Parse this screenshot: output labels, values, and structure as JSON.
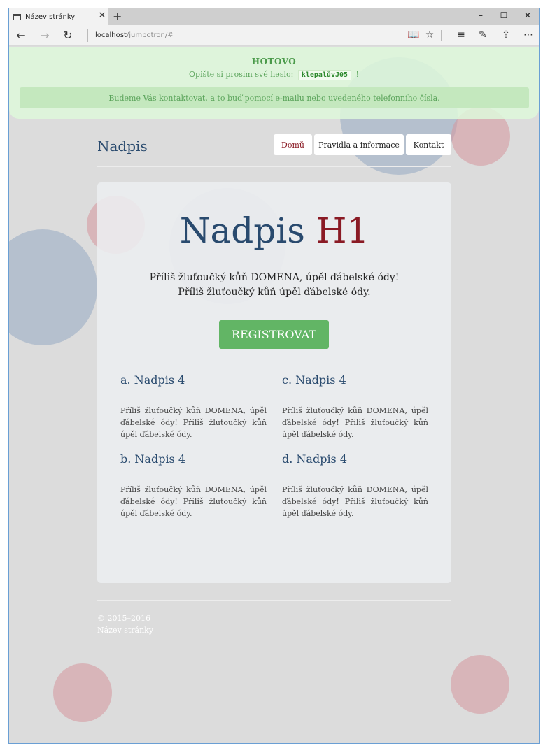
{
  "browser": {
    "tab_title": "Název stránky",
    "tab_close": "✕",
    "new_tab": "+",
    "url_host": "localhost",
    "url_path": "/jumbotron/#",
    "minimize": "–",
    "maximize": "☐",
    "close": "✕"
  },
  "alert": {
    "title": "HOTOVO",
    "prompt": "Opište si prosím své heslo:",
    "password": "klepalůvJ05",
    "suffix": "!",
    "info": "Budeme Vás kontaktovat, a to buď pomocí e-mailu nebo uvedeného telefonního čísla."
  },
  "nav": {
    "brand": "Nadpis",
    "items": [
      {
        "label": "Domů",
        "active": true
      },
      {
        "label": "Pravidla a informace",
        "active": false
      },
      {
        "label": "Kontakt",
        "active": false
      }
    ]
  },
  "jumbotron": {
    "title": "Nadpis",
    "title_accent": "H1",
    "lead_1": "Příliš žluťoučký kůň DOMENA, úpěl ďábelské ódy!",
    "lead_2": "Příliš žluťoučký kůň úpěl ďábelské ódy.",
    "button": "REGISTROVAT",
    "columns": [
      {
        "heading": "a. Nadpis 4",
        "text": "Příliš žluťoučký kůň DOMENA, úpěl ďábelské ódy! Příliš žluťoučký kůň úpěl ďábelské ódy."
      },
      {
        "heading": "c. Nadpis 4",
        "text": "Příliš žluťoučký kůň DOMENA, úpěl ďábelské ódy! Příliš žluťoučký kůň úpěl ďábelské ódy."
      },
      {
        "heading": "b. Nadpis 4",
        "text": "Příliš žluťoučký kůň DOMENA, úpěl ďábelské ódy! Příliš žluťoučký kůň úpěl ďábelské ódy."
      },
      {
        "heading": "d. Nadpis 4",
        "text": "Příliš žluťoučký kůň DOMENA, úpěl ďábelské ódy! Příliš žluťoučký kůň úpěl ďábelské ódy."
      }
    ]
  },
  "footer": {
    "copyright": "© 2015–2016",
    "site": "Název stránky"
  },
  "colors": {
    "brand_blue": "#294a6e",
    "accent_red": "#8a1a24",
    "success_green": "#62b565",
    "alert_bg": "#def8da"
  }
}
